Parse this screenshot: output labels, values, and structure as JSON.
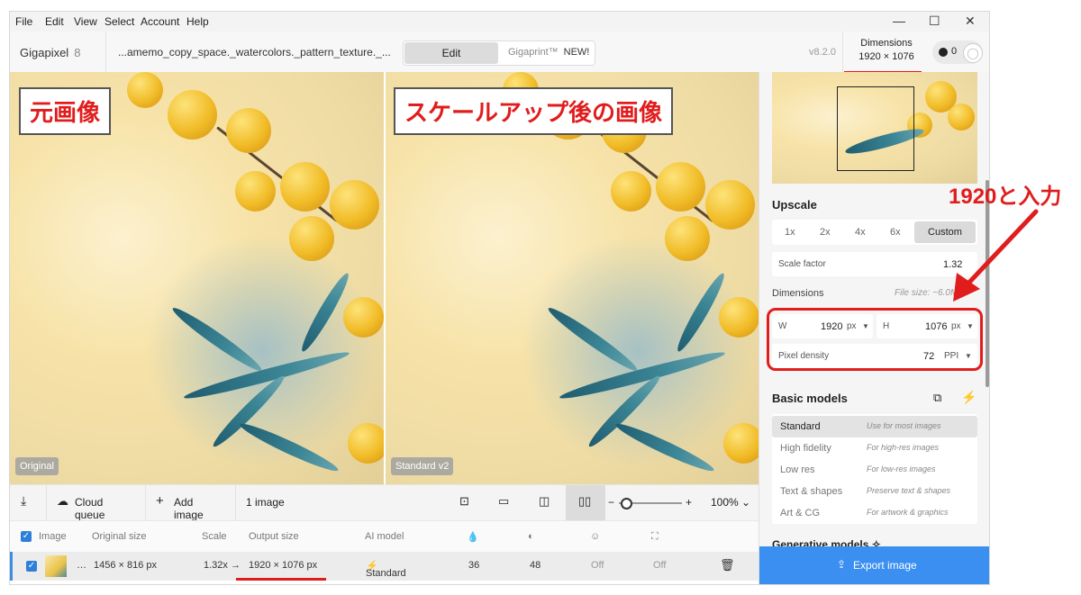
{
  "menu": [
    "File",
    "Edit",
    "View",
    "Select",
    "Account",
    "Help"
  ],
  "window_controls": {
    "minimize": "—",
    "maximize": "☐",
    "close": "✕"
  },
  "app": {
    "name": "Gigapixel",
    "version_badge": "8",
    "version": "v8.2.0",
    "file_name": "...amemo_copy_space._watercolors._pattern_texture._..."
  },
  "mode_tabs": {
    "edit": "Edit",
    "gigaprint": "Gigaprint™",
    "new_badge": "NEW!"
  },
  "header_dimensions": {
    "title": "Dimensions",
    "value": "1920 × 1076"
  },
  "credits": "0",
  "viewer": {
    "left_label": "元画像",
    "right_label": "スケールアップ後の画像",
    "left_tag": "Original",
    "right_tag": "Standard v2"
  },
  "toolbar": {
    "cloud_queue": "Cloud queue",
    "add_image": "Add image",
    "image_count": "1 image",
    "zoom": "100%"
  },
  "table": {
    "headers": [
      "Image",
      "Original size",
      "Scale",
      "Output size",
      "AI model"
    ],
    "row": {
      "original_size": "1456 × 816 px",
      "scale": "1.32x",
      "arrow": "→",
      "output_size": "1920 × 1076 px",
      "model": "Standard",
      "v1": "36",
      "v2": "48",
      "v3": "Off",
      "v4": "Off"
    }
  },
  "panel": {
    "upscale_title": "Upscale",
    "scales": [
      "1x",
      "2x",
      "4x",
      "6x"
    ],
    "custom": "Custom",
    "scale_factor_label": "Scale factor",
    "scale_factor_value": "1.32",
    "dimensions_label": "Dimensions",
    "file_size": "File size: ~6.0MB",
    "w_label": "W",
    "w_value": "1920",
    "w_unit": "px",
    "h_label": "H",
    "h_value": "1076",
    "h_unit": "px",
    "density_label": "Pixel density",
    "density_value": "72",
    "density_unit": "PPI",
    "basic_models_title": "Basic models",
    "models": [
      {
        "name": "Standard",
        "desc": "Use for most images"
      },
      {
        "name": "High fidelity",
        "desc": "For high-res images"
      },
      {
        "name": "Low res",
        "desc": "For low-res images"
      },
      {
        "name": "Text & shapes",
        "desc": "Preserve text & shapes"
      },
      {
        "name": "Art & CG",
        "desc": "For artwork & graphics"
      }
    ],
    "generative_models_title": "Generative models",
    "export": "Export image"
  },
  "annotation": "1920と入力",
  "colors": {
    "accent": "#3b8ff0",
    "highlight": "#e11c1c",
    "selected_row_border": "#3a8de0"
  }
}
